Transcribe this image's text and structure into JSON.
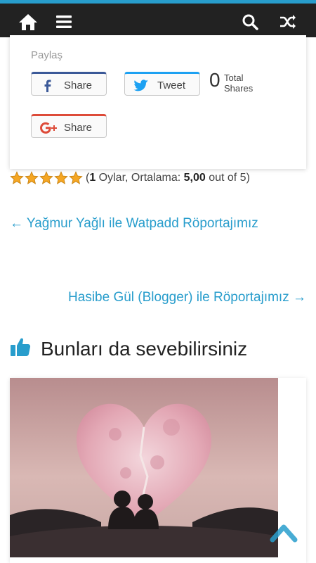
{
  "topbar": {
    "home_icon": "home-icon",
    "menu_icon": "hamburger-menu-icon",
    "search_icon": "search-icon",
    "random_icon": "shuffle-icon"
  },
  "share": {
    "title": "Paylaş",
    "facebook_label": "Share",
    "twitter_label": "Tweet",
    "google_label": "Share",
    "count": "0",
    "count_label_1": "Total",
    "count_label_2": "Shares"
  },
  "rating": {
    "stars": 5,
    "open": "(",
    "votes": "1",
    "votes_text": " Oylar, Ortalama: ",
    "average": "5,00",
    "suffix": " out of 5)"
  },
  "navigation": {
    "prev": "← Yağmur Yağlı ile Watpadd Röportajımız",
    "next": "Hasibe Gül (Blogger) ile Röportajımız →"
  },
  "related": {
    "title": "Bunları da sevebilirsiniz",
    "icon": "thumbs-up-icon"
  },
  "colors": {
    "accent": "#289dcc",
    "topbar": "#222222",
    "facebook": "#3b5998",
    "twitter": "#1da1f2",
    "google": "#dd4b39",
    "star": "#f5a623"
  }
}
